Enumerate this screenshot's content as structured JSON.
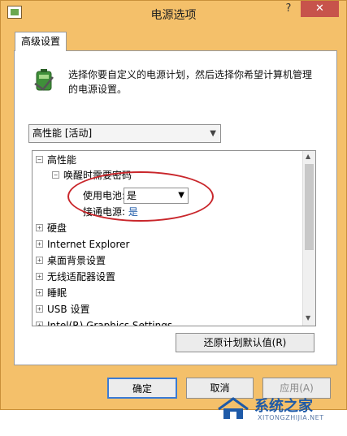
{
  "window": {
    "title": "电源选项",
    "help_label": "?",
    "close_label": "✕"
  },
  "tab": {
    "label": "高级设置"
  },
  "description": "选择你要自定义的电源计划，然后选择你希望计算机管理的电源设置。",
  "plan_select": {
    "value": "高性能 [活动]"
  },
  "tree": {
    "root": "高性能",
    "wake_password": "唤醒时需要密码",
    "on_battery_label": "使用电池:",
    "on_battery_value": "是",
    "plugged_in_label": "接通电源:",
    "plugged_in_value": "是",
    "items": [
      "硬盘",
      "Internet Explorer",
      "桌面背景设置",
      "无线适配器设置",
      "睡眠",
      "USB 设置",
      "Intel(R) Graphics Settings"
    ]
  },
  "buttons": {
    "restore": "还原计划默认值(R)",
    "ok": "确定",
    "cancel": "取消",
    "apply": "应用(A)"
  },
  "watermark": {
    "text": "系统之家",
    "sub": "XITONGZHIJIA.NET"
  }
}
